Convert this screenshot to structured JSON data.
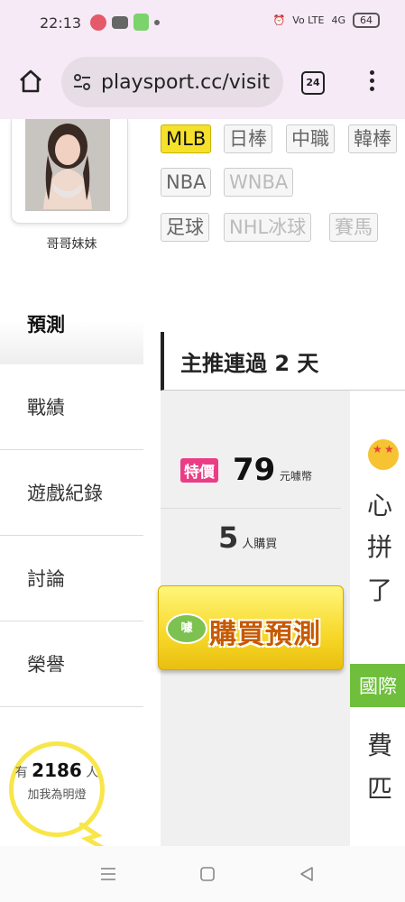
{
  "statusbar": {
    "time": "22:13",
    "volte": "Vo LTE",
    "network": "4G",
    "battery": "64"
  },
  "browser": {
    "url": "playsport.cc/visit",
    "tab_count": "24"
  },
  "sidebar": {
    "username": "哥哥妹妹",
    "nav": [
      {
        "label": "預測",
        "active": true
      },
      {
        "label": "戰績"
      },
      {
        "label": "遊戲紀錄"
      },
      {
        "label": "討論"
      },
      {
        "label": "榮譽"
      }
    ],
    "fans": {
      "prefix": "有",
      "count": "2186",
      "suffix": "人",
      "cta": "加我為明燈"
    }
  },
  "leagues": [
    {
      "label": "MLB",
      "state": "active"
    },
    {
      "label": "日棒",
      "state": "normal"
    },
    {
      "label": "中職",
      "state": "normal"
    },
    {
      "label": "韓棒",
      "state": "normal"
    },
    {
      "label": "NBA",
      "state": "normal"
    },
    {
      "label": "WNBA",
      "state": "disabled"
    },
    {
      "label": "足球",
      "state": "normal"
    },
    {
      "label": "NHL冰球",
      "state": "disabled"
    },
    {
      "label": "賽馬",
      "state": "disabled"
    }
  ],
  "pick": {
    "header": "主推連過 2 天",
    "badge": "特價",
    "price": "79",
    "unit": "元噱幣",
    "buyers_count": "5",
    "buyers_label": "人購買",
    "buy_button": "購買預測",
    "coin_label": "噱"
  },
  "preview": {
    "lines": [
      "心",
      "拼",
      "了"
    ],
    "category": "國際",
    "lines2": [
      "費",
      "匹"
    ]
  }
}
